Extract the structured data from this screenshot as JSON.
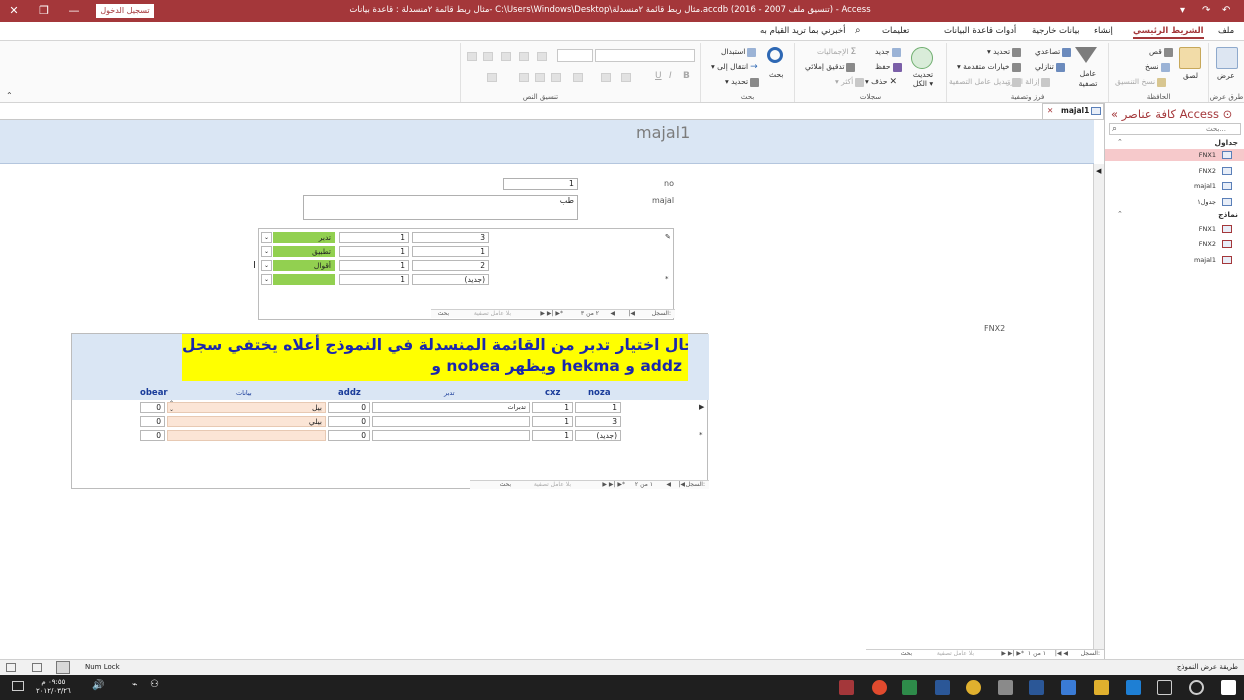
{
  "titlebar": {
    "title": "مثال ربط قائمة ٢منسدلة : قاعدة بيانات- C:\\Users\\Windows\\Desktop\\مثال ربط قائمة ٢منسدلة.accdb (تنسيق ملف 2007 - 2016)  -  Access",
    "signin": "تسجيل الدخول",
    "help_btn": "?",
    "minimize": "—",
    "restore": "❐",
    "close": "✕",
    "qat": [
      "↶",
      "↷",
      "▾"
    ]
  },
  "tabs": {
    "file": "ملف",
    "home": "الشريط الرئيسي",
    "create": "إنشاء",
    "external": "بيانات خارجية",
    "dbtools": "أدوات قاعدة البيانات",
    "help": "تعليمات",
    "tellme": "أخبرني بما تريد القيام به"
  },
  "ribbon": {
    "views": {
      "view": "عرض",
      "label": "طرق عرض"
    },
    "clipboard": {
      "paste": "لصق",
      "cut": "قص",
      "copy": "نسخ",
      "format_painter": "نسخ التنسيق",
      "label": "الحافظة"
    },
    "sort": {
      "filter": "عامل تصفية",
      "asc": "تصاعدي",
      "desc": "تنازلي",
      "remove_sort": "إزالة الفرز",
      "selection": "تحديد",
      "advanced": "خيارات متقدمة",
      "toggle": "تبديل عامل التصفية",
      "label": "فرز وتصفية"
    },
    "records": {
      "refresh_all": "تحديث الكل",
      "new": "جديد",
      "save": "حفظ",
      "delete": "حذف",
      "totals": "الإجماليات",
      "spelling": "تدقيق إملائي",
      "more": "أكثر",
      "label": "سجلات"
    },
    "find": {
      "find": "بحث",
      "replace": "استبدال",
      "goto": "انتقال إلى",
      "select": "تحديد",
      "label": "بحث"
    },
    "textfmt": {
      "label": "تنسيق النص",
      "bold": "B",
      "italic": "I",
      "underline": "U"
    }
  },
  "nav": {
    "title": "كافة عناصر Access",
    "search_placeholder": "بحث...",
    "tables_header": "جداول",
    "tables": [
      "FNX1",
      "FNX2",
      "majal1",
      "جدول١"
    ],
    "forms_header": "نماذج",
    "forms": [
      "FNX1",
      "FNX2",
      "majal1"
    ]
  },
  "doc_tab": {
    "label": "majal1",
    "close": "✕"
  },
  "form": {
    "title": "majal1",
    "no_label": "no",
    "no_value": "1",
    "majal_label": "majal",
    "majal_value": "طب",
    "fnx2_label": "FNX2"
  },
  "subform1": {
    "rows": [
      {
        "selector": "✎",
        "col1": "3",
        "col2": "1",
        "combo": "تدبر"
      },
      {
        "selector": "",
        "col1": "1",
        "col2": "1",
        "combo": "تطبيق"
      },
      {
        "selector": "",
        "col1": "2",
        "col2": "1",
        "combo": "أقوال"
      },
      {
        "selector": "*",
        "col1": "(جديد)",
        "col2": "1",
        "combo": ""
      }
    ],
    "nav": {
      "record_label": "السجل:",
      "position": "٢ من ٣",
      "filter": "بلا عامل تصفية",
      "search": "بحث"
    }
  },
  "subform2": {
    "banner_line1": "كرما في حال اختيار تدبر من القائمة المنسدلة في النموذج أعلاه يختفي سجل beanx",
    "banner_line2": "و nobea ويظهر hekma  و addz",
    "headers": {
      "noza": "noza",
      "cxz": "cxz",
      "tadabbur": "تدبر",
      "addz": "addz",
      "bayanat": "بيانات",
      "obear": "obear"
    },
    "rows": [
      {
        "selector": "▶",
        "noza": "1",
        "cxz": "1",
        "tadabbur": "تدبرات",
        "addz": "0",
        "bayanat": "بيل",
        "obear": "0"
      },
      {
        "selector": "",
        "noza": "3",
        "cxz": "1",
        "tadabbur": "",
        "addz": "0",
        "bayanat": "بيلي",
        "obear": "0"
      },
      {
        "selector": "*",
        "noza": "(جديد)",
        "cxz": "1",
        "tadabbur": "",
        "addz": "0",
        "bayanat": "",
        "obear": "0"
      }
    ],
    "nav": {
      "record_label": "السجل:",
      "position": "١ من ٢",
      "filter": "بلا عامل تصفية",
      "search": "بحث"
    }
  },
  "main_nav": {
    "record_label": "السجل:",
    "position": "١ من ١",
    "filter": "بلا عامل تصفية",
    "search": "بحث"
  },
  "status": {
    "mode": "طريقة عرض النموذج",
    "numlock": "Num Lock"
  },
  "taskbar": {
    "time": "٠٩:٥٥ م",
    "date": "٢٠١٢/٠٣/٢٦"
  }
}
